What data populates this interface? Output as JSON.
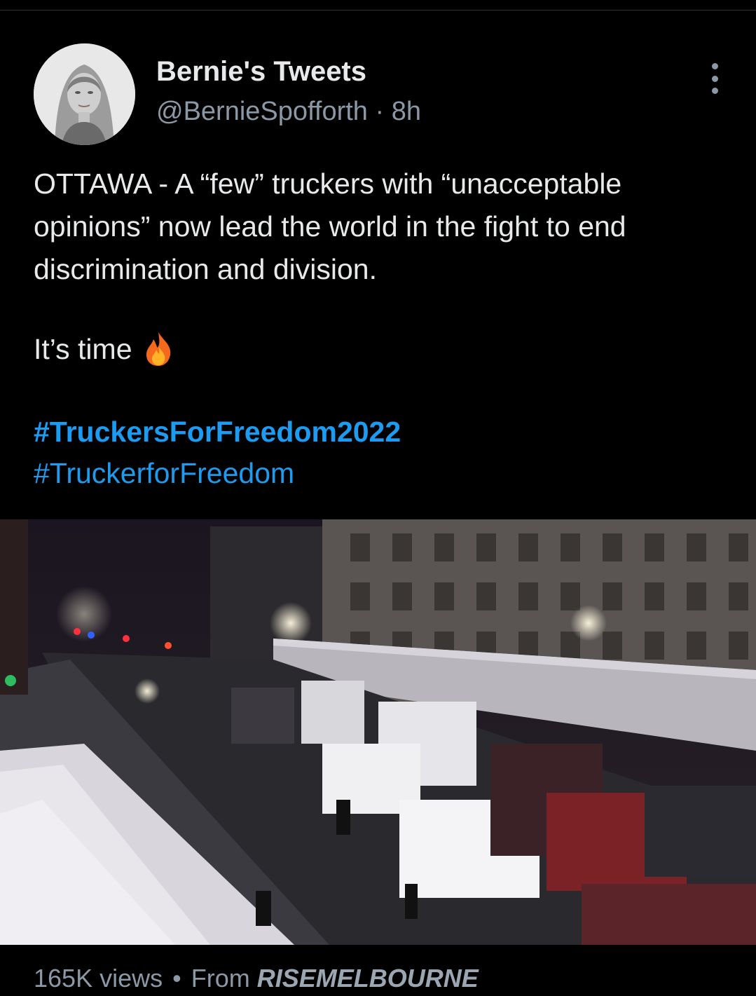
{
  "tweet": {
    "display_name": "Bernie's Tweets",
    "handle": "@BernieSpofforth",
    "separator": "·",
    "time": "8h",
    "text_lines": [
      "OTTAWA  -  A “few” truckers with “unacceptable",
      "opinions” now lead the world in the fight to end",
      "discrimination and division."
    ],
    "second_line": "It’s time",
    "emoji_icon": "fire-icon",
    "hashtags": [
      "#TruckersForFreedom2022",
      "#TruckerforFreedom"
    ]
  },
  "video": {
    "views": "165K views",
    "bullet": "•",
    "from_label": "From",
    "source": "RISEMELBOURNE"
  },
  "colors": {
    "background": "#000000",
    "text": "#e7e9ea",
    "secondary": "#8b98a5",
    "link": "#1d9bf0"
  }
}
